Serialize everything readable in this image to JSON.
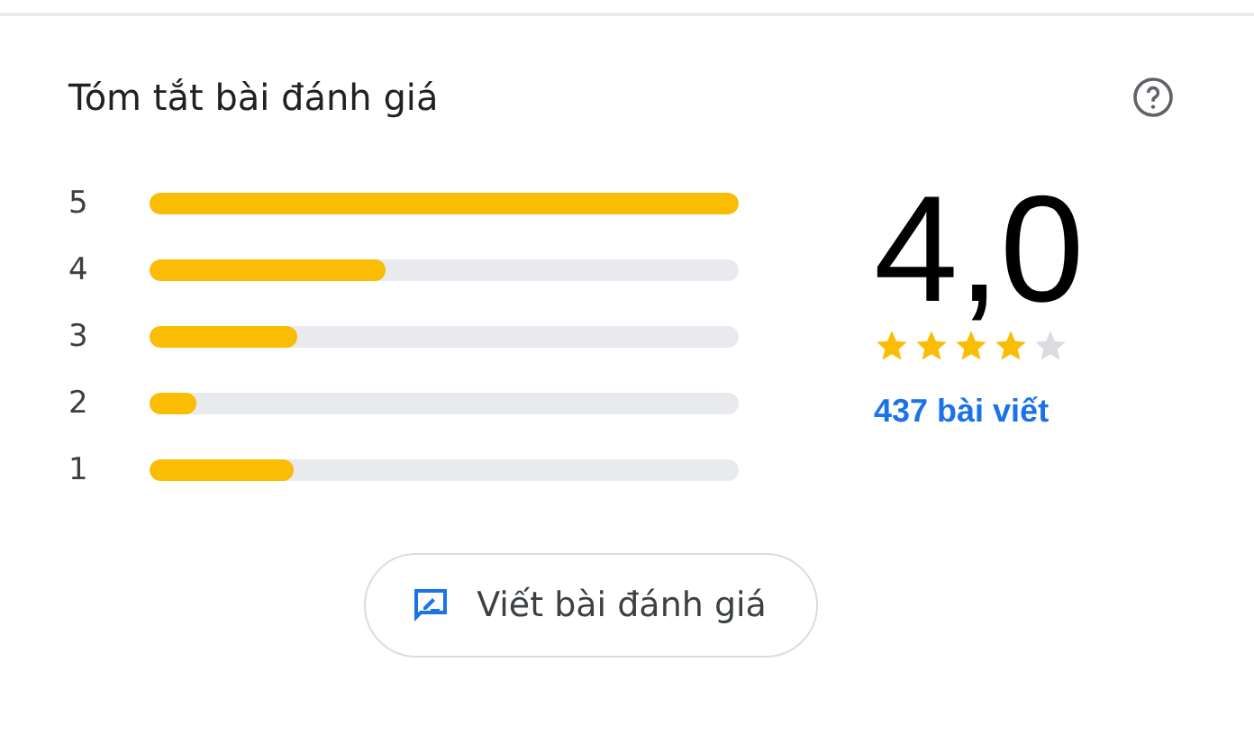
{
  "summary": {
    "title": "Tóm tắt bài đánh giá",
    "rows": [
      {
        "label": "5",
        "level": 1
      },
      {
        "label": "4",
        "level": 0.4
      },
      {
        "label": "3",
        "level": 0.25
      },
      {
        "label": "2",
        "level": 0.08
      },
      {
        "label": "1",
        "level": 0.245
      }
    ],
    "score": "4,0",
    "stars": 4,
    "reviews_link": "437 bài viết",
    "write_button": "Viết bài đánh giá"
  }
}
